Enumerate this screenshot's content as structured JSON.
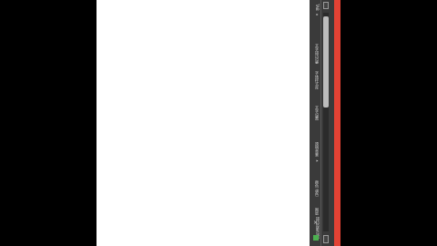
{
  "panel": {
    "items": [
      {
        "label": "TAB  ▸"
      },
      {
        "label": "文字描边设置"
      },
      {
        "label": "字体样式库 ▸"
      },
      {
        "label": "文字设置 ▸"
      },
      {
        "label": "透明背景 ▸"
      },
      {
        "label": "颜色  调色"
      },
      {
        "label": "图层混合效果"
      },
      {
        "label": "描边投影设置"
      }
    ],
    "close_glyph": "×"
  },
  "scrollbar": {
    "position": "top"
  },
  "colors": {
    "canvas": "#ffffff",
    "panel": "#3a3a3a",
    "accent": "#e34234"
  }
}
